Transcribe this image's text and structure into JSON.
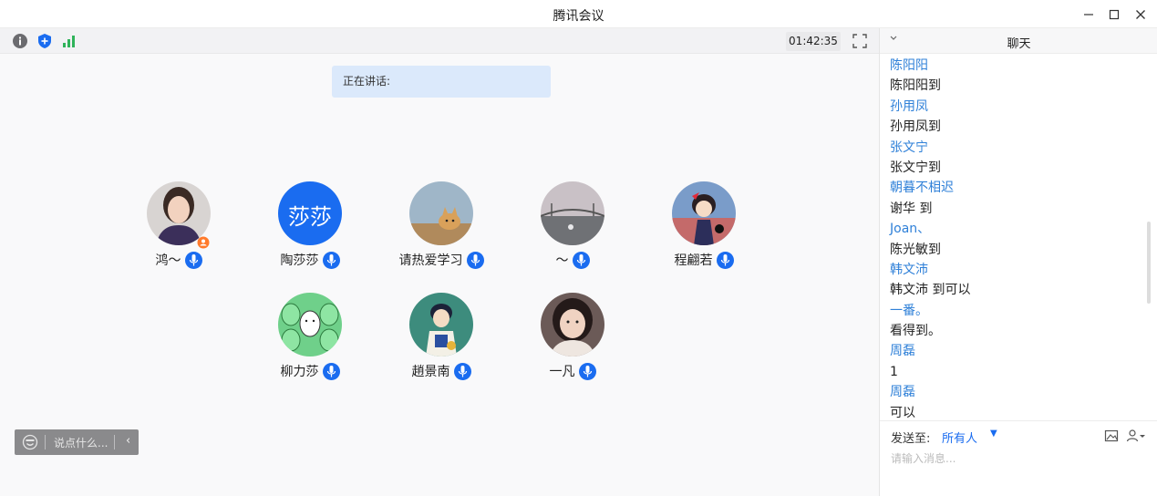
{
  "window": {
    "title": "腾讯会议",
    "controls": [
      "minimize",
      "maximize",
      "close"
    ]
  },
  "toolbar": {
    "icons": [
      "info-icon",
      "shield-icon",
      "signal-icon"
    ],
    "timer": "01:42:35",
    "fullscreen_icon": "fullscreen-icon"
  },
  "stage": {
    "speaking_label": "正在讲话:",
    "participants": [
      {
        "name": "鸿～",
        "avatar": "photo-woman",
        "host": true
      },
      {
        "name": "陶莎莎",
        "avatar": "text",
        "avatar_text": "莎莎",
        "avatar_color": "#1a6cf0"
      },
      {
        "name": "请热爱学习",
        "avatar": "photo-cat"
      },
      {
        "name": "～",
        "avatar": "photo-bridge"
      },
      {
        "name": "程翩若",
        "avatar": "anime-girl"
      },
      {
        "name": "柳力莎",
        "avatar": "cartoon-green"
      },
      {
        "name": "趙景南",
        "avatar": "anime-boy"
      },
      {
        "name": "一凡",
        "avatar": "photo-girl"
      }
    ],
    "chat_input_placeholder": "说点什么..."
  },
  "chat": {
    "title": "聊天",
    "messages": [
      {
        "text": "陈阳阳",
        "kind": "sender"
      },
      {
        "text": "陈阳阳到",
        "kind": "body"
      },
      {
        "text": "孙用凤",
        "kind": "sender"
      },
      {
        "text": "孙用凤到",
        "kind": "body"
      },
      {
        "text": "张文宁",
        "kind": "sender"
      },
      {
        "text": "张文宁到",
        "kind": "body"
      },
      {
        "text": "朝暮不相迟",
        "kind": "sender"
      },
      {
        "text": "谢华 到",
        "kind": "body"
      },
      {
        "text": "Joan、",
        "kind": "sender"
      },
      {
        "text": "陈光敏到",
        "kind": "body"
      },
      {
        "text": "韩文沛",
        "kind": "sender"
      },
      {
        "text": "韩文沛 到可以",
        "kind": "body"
      },
      {
        "text": "一番。",
        "kind": "sender"
      },
      {
        "text": "看得到。",
        "kind": "body"
      },
      {
        "text": "周磊",
        "kind": "sender"
      },
      {
        "text": "1",
        "kind": "body"
      },
      {
        "text": "周磊",
        "kind": "sender"
      },
      {
        "text": "可以",
        "kind": "body"
      }
    ],
    "send_to_label": "发送至:",
    "send_to_value": "所有人",
    "input_placeholder": "请输入消息..."
  },
  "colors": {
    "accent": "#1a6cf0",
    "sender": "#2f80d8",
    "speaking_bg": "#dbe9fb"
  }
}
